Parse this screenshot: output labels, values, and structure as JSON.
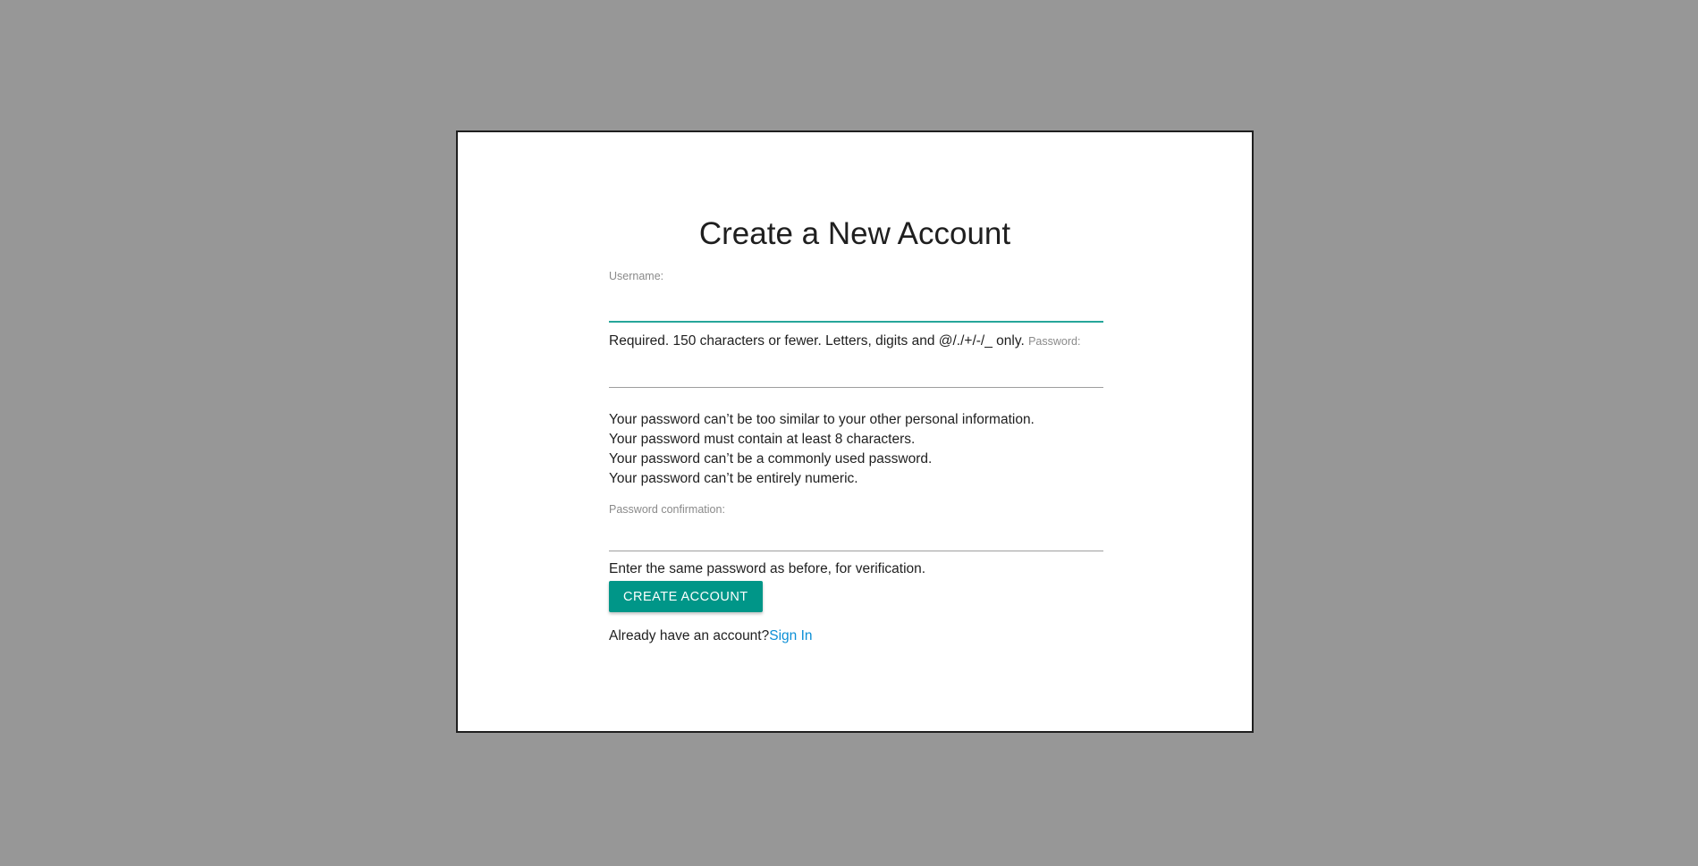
{
  "page": {
    "title": "Create a New Account"
  },
  "form": {
    "username": {
      "label": "Username:",
      "value": "",
      "help": "Required. 150 characters or fewer. Letters, digits and @/./+/-/_ only."
    },
    "password": {
      "label": "Password:",
      "value": "",
      "help_items": [
        "Your password can’t be too similar to your other personal information.",
        "Your password must contain at least 8 characters.",
        "Your password can’t be a commonly used password.",
        "Your password can’t be entirely numeric."
      ]
    },
    "password_confirmation": {
      "label": "Password confirmation:",
      "value": "",
      "help": "Enter the same password as before, for verification."
    },
    "submit_label": "CREATE ACCOUNT"
  },
  "footer": {
    "prompt": "Already have an account?",
    "link_label": "Sign In"
  },
  "colors": {
    "backdrop": "#979797",
    "accent": "#009688",
    "focus_underline": "#26a69a",
    "link": "#0c8fd6"
  }
}
